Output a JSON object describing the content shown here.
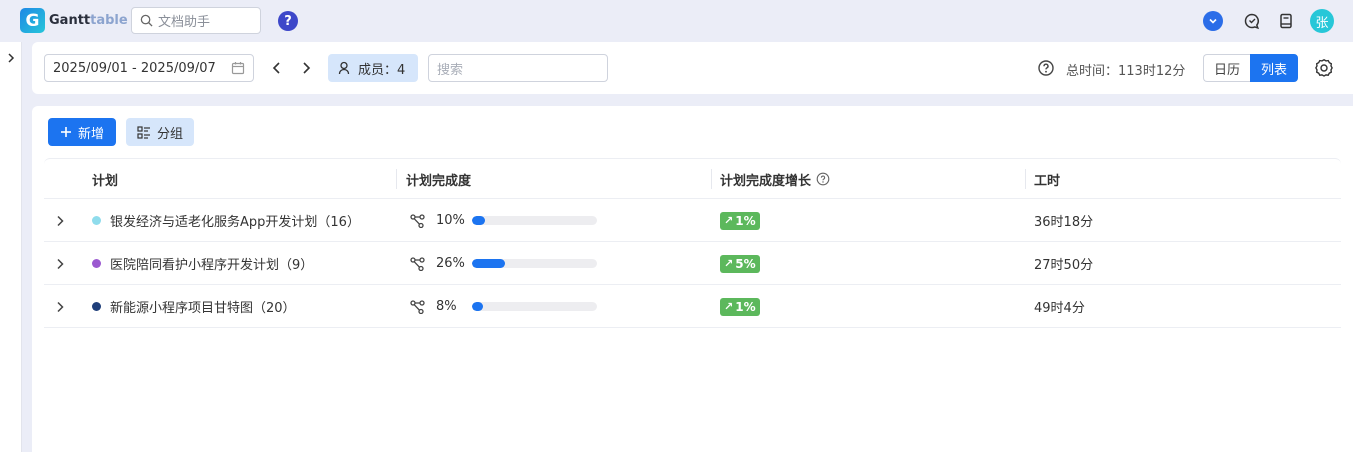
{
  "app": {
    "logo_letter": "G",
    "logo_part1": "Gantt",
    "logo_part2": "table",
    "search_placeholder": "文档助手",
    "help_label": "?",
    "avatar_text": "张"
  },
  "filters": {
    "date_range": "2025/09/01 - 2025/09/07",
    "members_label": "成员：4",
    "search_placeholder": "搜索",
    "total_time_label": "总时间：",
    "total_time_value": "113时12分",
    "view_calendar": "日历",
    "view_list": "列表",
    "active_view": "列表"
  },
  "toolbar": {
    "add_label": "新增",
    "group_label": "分组"
  },
  "table": {
    "columns": {
      "plan": "计划",
      "progress": "计划完成度",
      "growth": "计划完成度增长",
      "hours": "工时"
    },
    "rows": [
      {
        "name": "银发经济与适老化服务App开发计划（16）",
        "dot_color": "#8fdcec",
        "progress_text": "10%",
        "progress": 10,
        "growth": "1%",
        "hours": "36时18分"
      },
      {
        "name": "医院陪同看护小程序开发计划（9）",
        "dot_color": "#9b59d0",
        "progress_text": "26%",
        "progress": 26,
        "growth": "5%",
        "hours": "27时50分"
      },
      {
        "name": "新能源小程序项目甘特图（20）",
        "dot_color": "#1f3f7a",
        "progress_text": "8%",
        "progress": 8,
        "growth": "1%",
        "hours": "49时4分"
      }
    ]
  },
  "colors": {
    "primary": "#1c74f0",
    "growth_badge": "#5cb85c",
    "member_chip": "#d6e6fb"
  },
  "icons": {
    "top_search": "search-icon",
    "help": "help-circle-icon",
    "dropdown": "chevron-down-circle-icon",
    "chat": "chat-icon",
    "book": "book-icon",
    "calendar": "calendar-icon",
    "member": "person-icon",
    "question": "question-circle-icon",
    "settings": "gear-icon",
    "add": "plus-icon",
    "group": "group-list-icon",
    "expand": "chevron-right-icon",
    "progress": "share-nodes-icon"
  }
}
